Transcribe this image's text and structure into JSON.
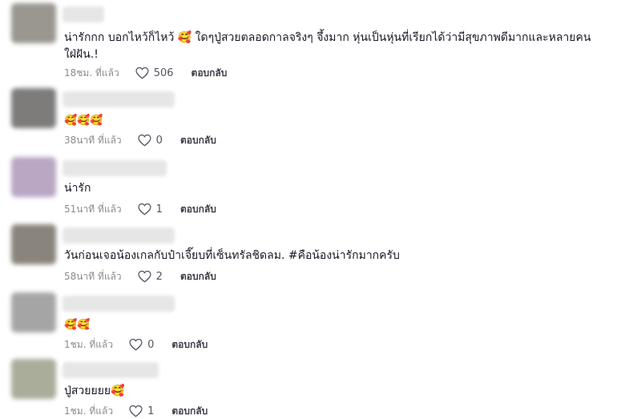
{
  "comments": [
    {
      "text": "น่ารักกก บอกไหว้ก็ไหว้ 🥰 ใดๆปู่สวยตลอดกาลจริงๆ จึ้งมาก หุ่นเป็นหุ่นที่เรียกได้ว่ามีสุขภาพดีมากและหลายคนใฝ่ฝัน.!",
      "time": "18ชม. ที่แล้ว",
      "likes": "506",
      "reply": "ตอบกลับ",
      "avatar_color": "#9a9690"
    },
    {
      "text": "🥰🥰🥰",
      "time": "38นาที ที่แล้ว",
      "likes": "0",
      "reply": "ตอบกลับ",
      "avatar_color": "#7d7c7b"
    },
    {
      "text": "น่ารัก",
      "time": "51นาที ที่แล้ว",
      "likes": "1",
      "reply": "ตอบกลับ",
      "avatar_color": "#b9a7c4"
    },
    {
      "text": "วันก่อนเจอน้องเกลกับป๋าเจี๊ยบที่เซ็นทรัลชิดลม. #คือน้องน่ารักมากครับ",
      "time": "58นาที ที่แล้ว",
      "likes": "2",
      "reply": "ตอบกลับ",
      "avatar_color": "#8a857c"
    },
    {
      "text": "🥰🥰",
      "time": "1ชม. ที่แล้ว",
      "likes": "0",
      "reply": "ตอบกลับ",
      "avatar_color": "#a5a5a5"
    },
    {
      "text": "ปู่สวยยยย🥰",
      "time": "1ชม. ที่แล้ว",
      "likes": "1",
      "reply": "ตอบกลับ",
      "avatar_color": "#a9ad9a"
    }
  ]
}
